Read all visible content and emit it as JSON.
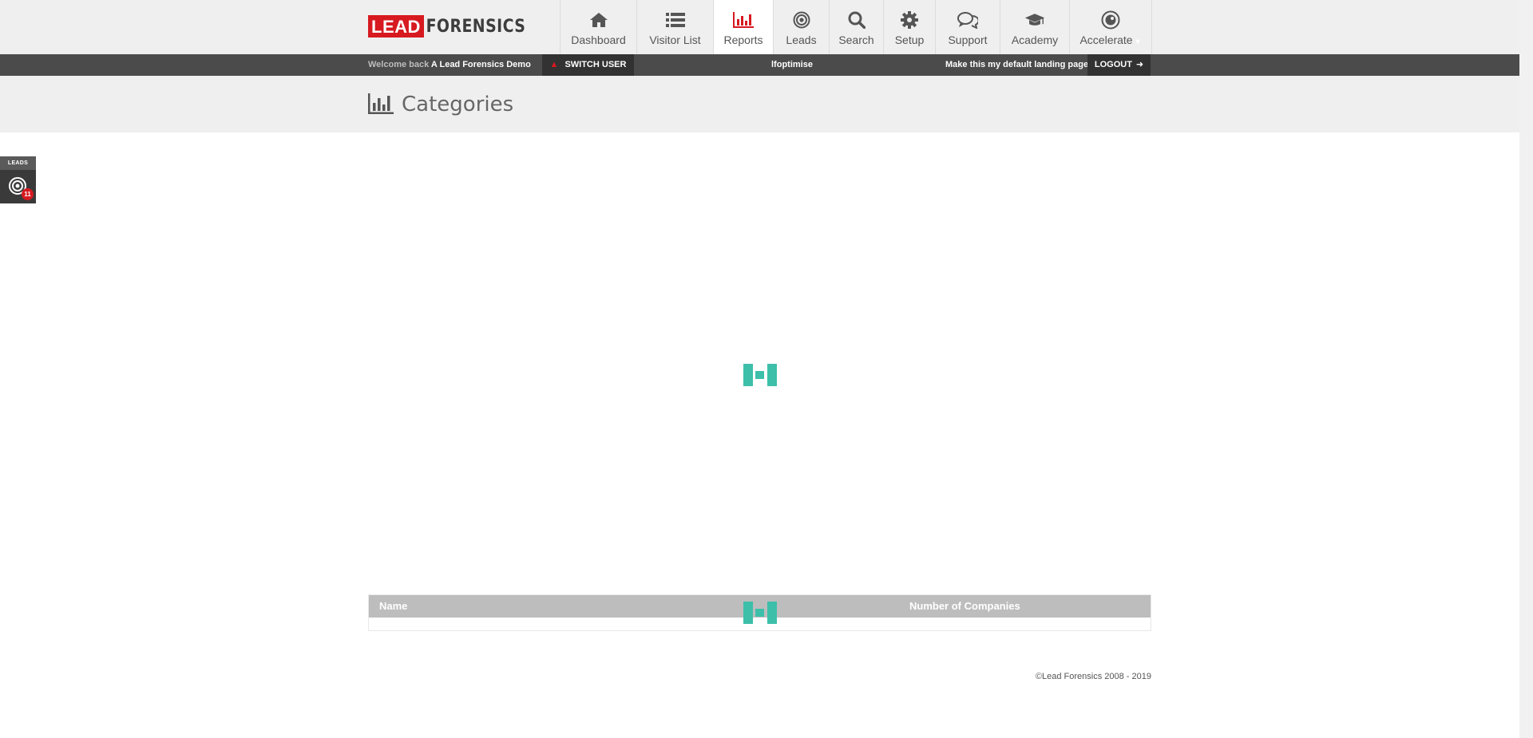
{
  "brand": {
    "logo_lead": "LEAD",
    "logo_forensics": "FORENSICS",
    "accent": "#d71920"
  },
  "nav": {
    "items": [
      {
        "label": "Dashboard",
        "icon": "home-icon"
      },
      {
        "label": "Visitor List",
        "icon": "list-icon"
      },
      {
        "label": "Reports",
        "icon": "bar-chart-icon",
        "active": true
      },
      {
        "label": "Leads",
        "icon": "target-icon"
      },
      {
        "label": "Search",
        "icon": "search-icon"
      },
      {
        "label": "Setup",
        "icon": "gear-icon"
      },
      {
        "label": "Support",
        "icon": "chat-icon"
      },
      {
        "label": "Academy",
        "icon": "graduation-cap-icon"
      },
      {
        "label": "Accelerate",
        "icon": "accelerate-icon"
      }
    ],
    "accelerate_caret": "▼"
  },
  "userbar": {
    "welcome_prefix": "Welcome back",
    "user_name": "A Lead Forensics Demo",
    "switch_user": "SWITCH USER",
    "account": "lfoptimise",
    "default_landing": "Make this my default landing page",
    "logout": "LOGOUT"
  },
  "page": {
    "title": "Categories",
    "icon": "bar-chart-icon"
  },
  "leads_tab": {
    "label": "LEADS",
    "count": "11"
  },
  "table": {
    "columns": [
      "Name",
      "Number of Companies"
    ]
  },
  "footer": {
    "copyright": "©Lead Forensics 2008 - 2019"
  },
  "colors": {
    "loader": "#3dbfaa",
    "userbar_bg": "#4b4b4b",
    "header_bg": "#efefef"
  }
}
